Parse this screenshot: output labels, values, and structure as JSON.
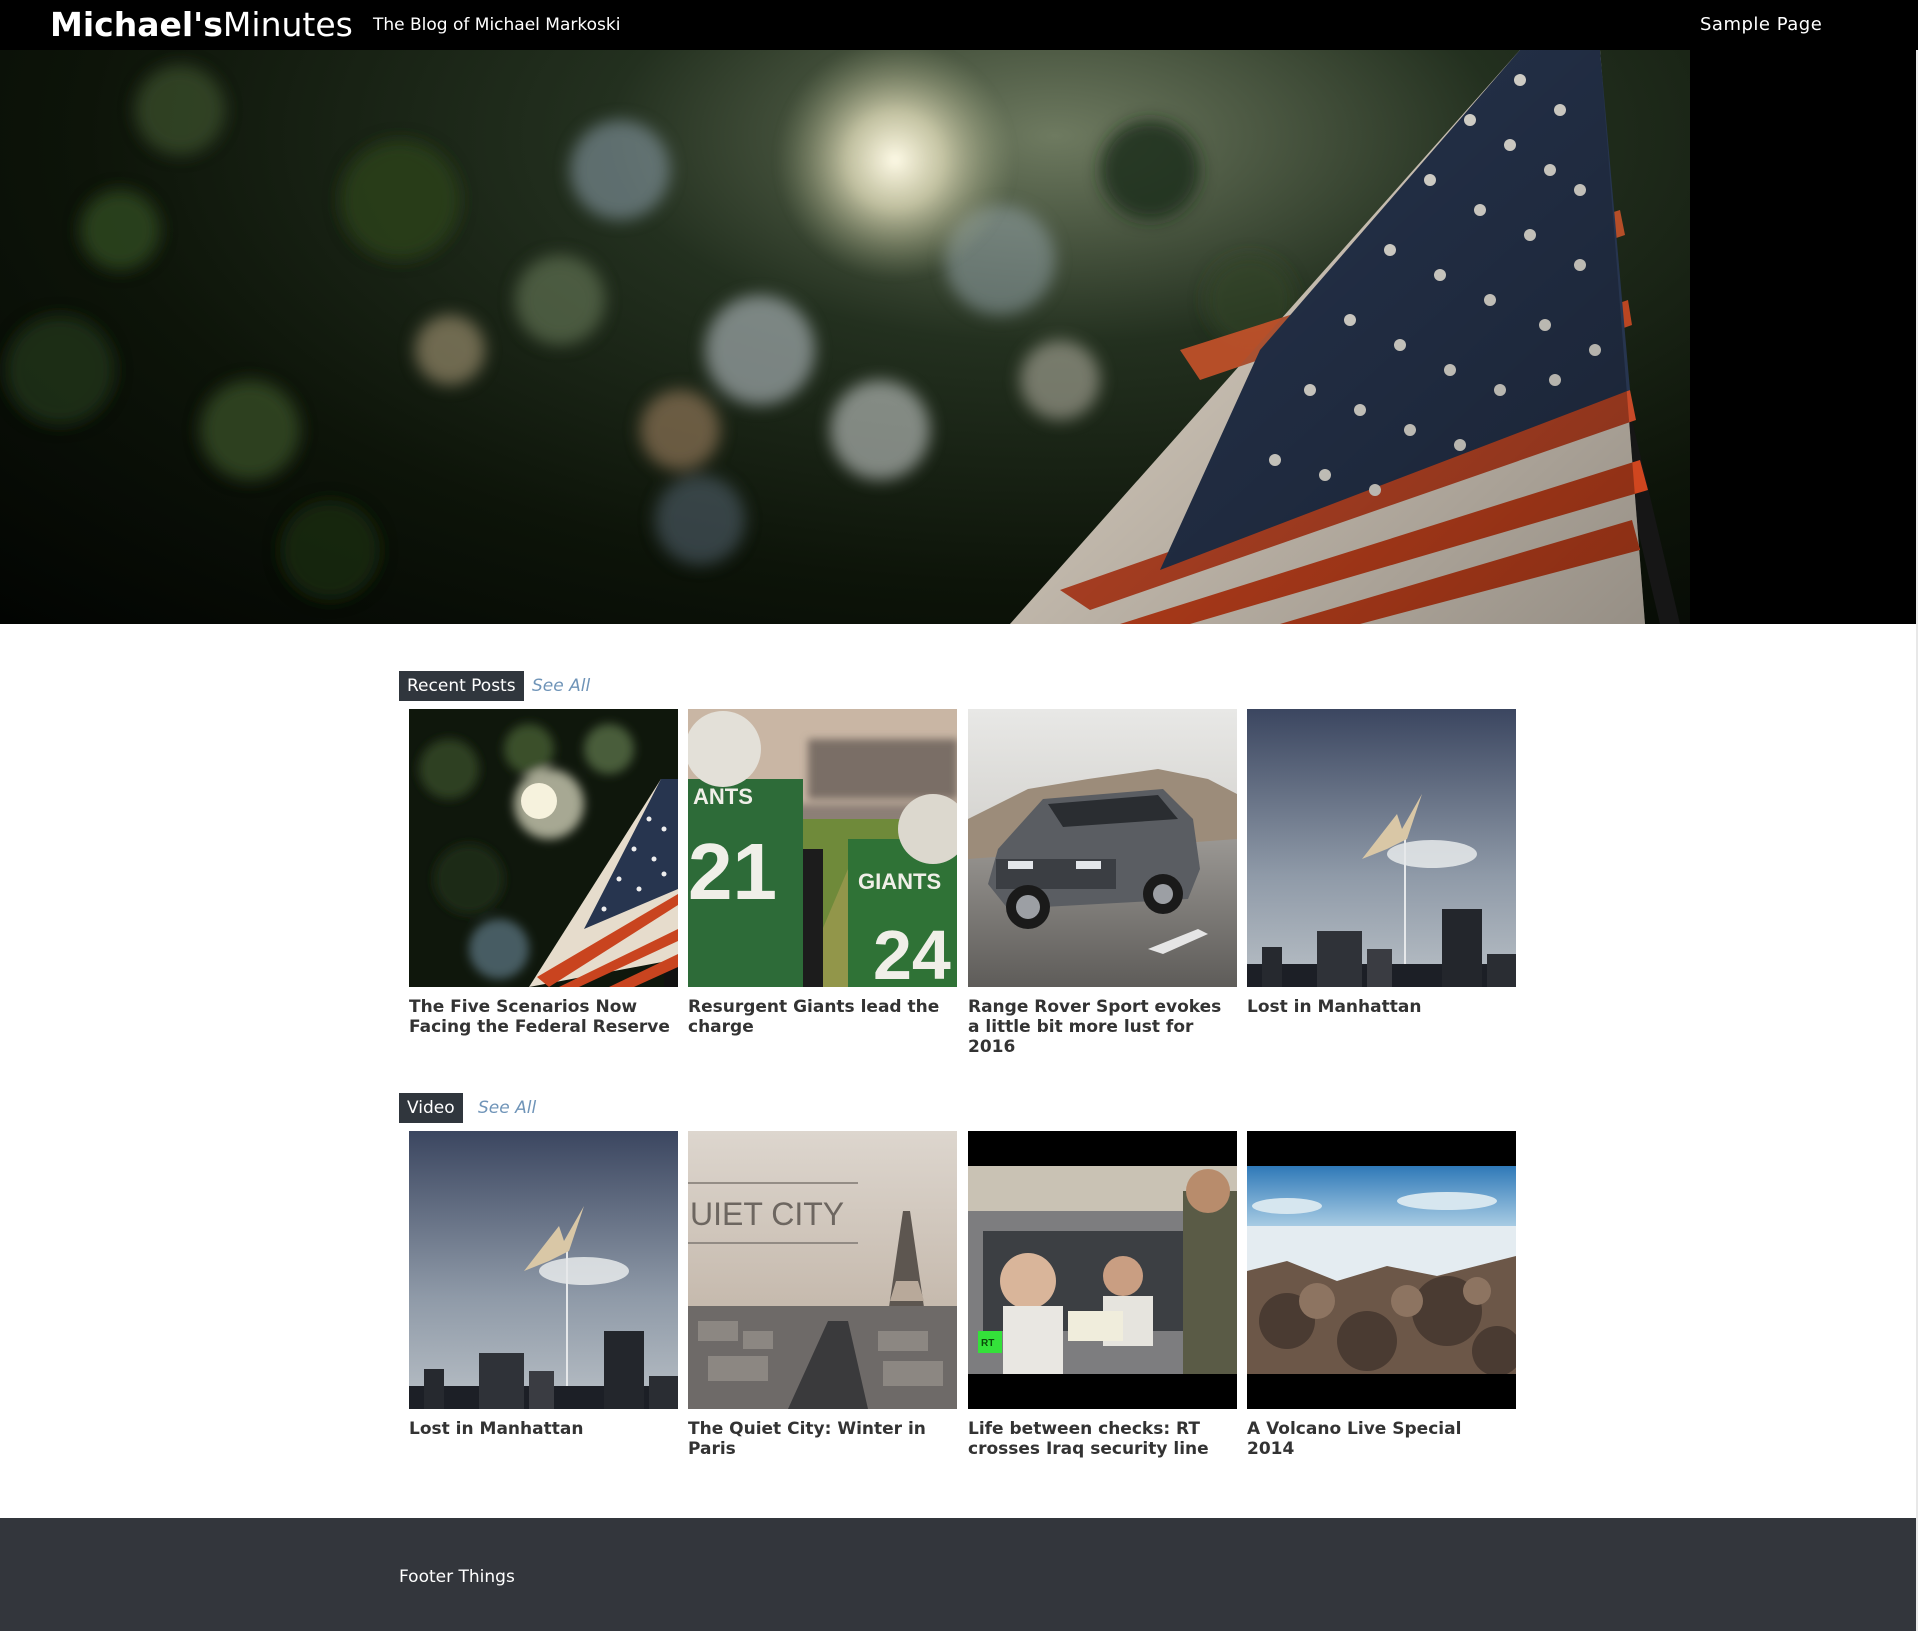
{
  "header": {
    "brand_bold": "Michael's",
    "brand_light": "Minutes",
    "tagline": "The Blog of Michael Markoski",
    "nav": [
      {
        "label": "Sample Page"
      }
    ]
  },
  "hero": {
    "image": "american-flag-in-trees"
  },
  "sections": {
    "recent": {
      "label": "Recent Posts",
      "see_all": "See All",
      "posts": [
        {
          "title": "The Five Scenarios Now Facing the Federal Reserve",
          "image": "flag-trees"
        },
        {
          "title": "Resurgent Giants lead the charge",
          "image": "football-players"
        },
        {
          "title": "Range Rover Sport evokes a little bit more lust for 2016",
          "image": "grey-suv"
        },
        {
          "title": "Lost in Manhattan",
          "image": "bird-over-skyline"
        }
      ]
    },
    "video": {
      "label": "Video",
      "see_all": "See All",
      "posts": [
        {
          "title": "Lost in Manhattan",
          "image": "bird-over-skyline"
        },
        {
          "title": "The Quiet City: Winter in Paris",
          "image": "paris-eiffel-tower",
          "overlay_text": "UIET  CITY"
        },
        {
          "title": "Life between checks: RT crosses Iraq security line",
          "image": "car-checkpoint",
          "badge": "RT"
        },
        {
          "title": "A Volcano Live Special 2014",
          "image": "volcano-rocks-ocean"
        }
      ]
    }
  },
  "footer": {
    "text": "Footer Things"
  },
  "colors": {
    "topbar": "#000000",
    "section_tag_bg": "#30363d",
    "see_all": "#6f94b8",
    "footer_bg": "#33363c",
    "rt_badge": "#34e13a"
  }
}
